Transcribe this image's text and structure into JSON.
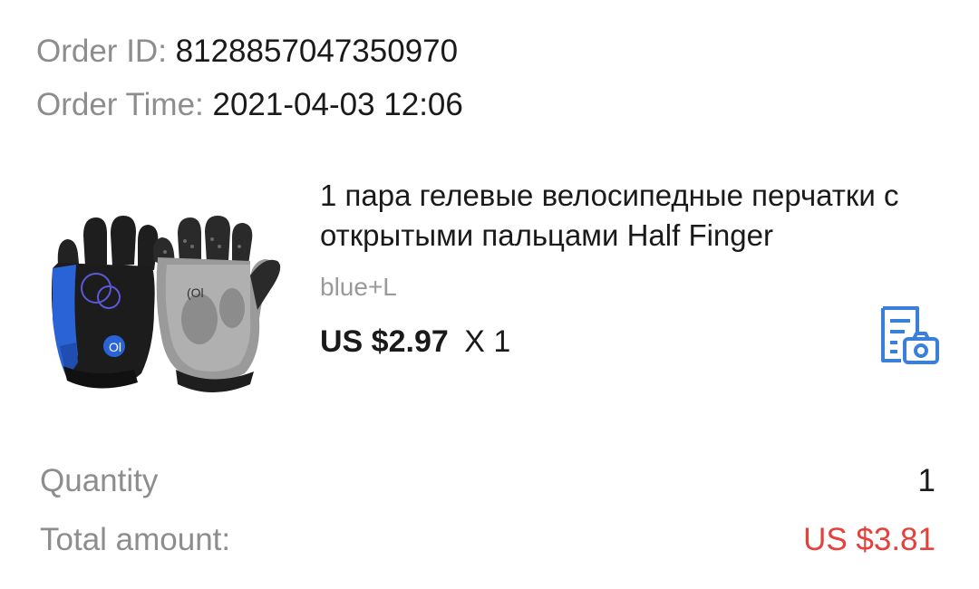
{
  "order": {
    "id_label": "Order ID:",
    "id_value": "8128857047350970",
    "time_label": "Order Time:",
    "time_value": "2021-04-03 12:06"
  },
  "product": {
    "title": "1 пара гелевые велосипедные перчатки с открытыми пальцами Half Finger",
    "variant": "blue+L",
    "price": "US $2.97",
    "quantity_text": "X 1",
    "image_icon": "cycling-gloves-image",
    "snapshot_icon": "document-camera-icon"
  },
  "summary": {
    "quantity_label": "Quantity",
    "quantity_value": "1",
    "total_label": "Total amount:",
    "total_value": "US $3.81"
  },
  "colors": {
    "total_price": "#e6403a",
    "accent_blue": "#3a7fd8",
    "label_gray": "#8d8d8d"
  }
}
